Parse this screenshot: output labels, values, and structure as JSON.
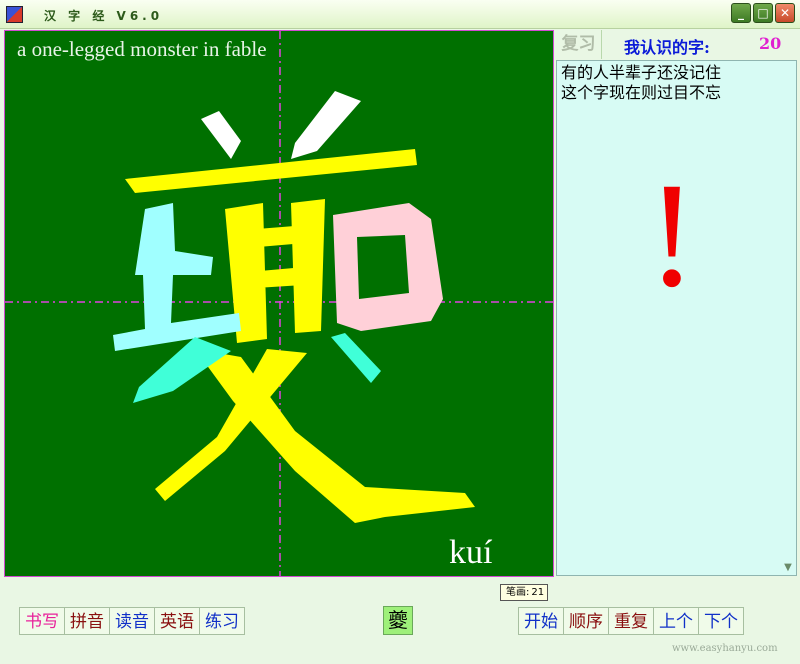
{
  "window": {
    "title": "汉 字 经 V6.0",
    "buttons": {
      "minimize": "_",
      "maximize": "□",
      "close": "✕"
    }
  },
  "board": {
    "english": "a one-legged monster in fable",
    "pinyin": "kuí",
    "character": "夔"
  },
  "side": {
    "review_label": "复习",
    "known_label": "我认识的字:",
    "known_count": "20",
    "note_lines": [
      "有的人半辈子还没记住",
      "这个字现在则过目不忘"
    ],
    "exclaim": "!"
  },
  "tooltip": {
    "label": "笔画:",
    "value": "21"
  },
  "left_buttons": [
    {
      "label": "书写",
      "color": "#e8209a"
    },
    {
      "label": "拼音",
      "color": "#8a1010"
    },
    {
      "label": "读音",
      "color": "#1030c8"
    },
    {
      "label": "英语",
      "color": "#8a1010"
    },
    {
      "label": "练习",
      "color": "#1030c8"
    }
  ],
  "current_char": "夔",
  "right_buttons": [
    {
      "label": "开始",
      "color": "#1030c8"
    },
    {
      "label": "顺序",
      "color": "#8a1010"
    },
    {
      "label": "重复",
      "color": "#8a1010"
    },
    {
      "label": "上个",
      "color": "#1030c8"
    },
    {
      "label": "下个",
      "color": "#1030c8"
    }
  ],
  "footer": "www.easyhanyu.com",
  "colors": {
    "board": "#007000",
    "guide": "#e040e0",
    "exclaim": "#f00000"
  }
}
